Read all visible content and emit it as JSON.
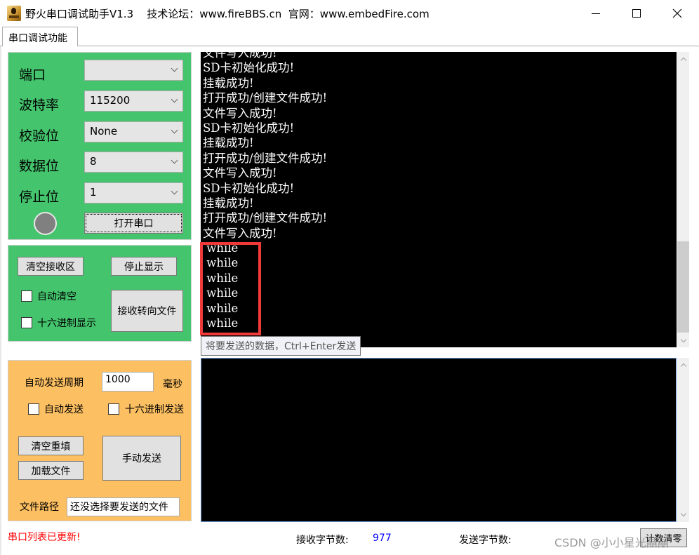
{
  "window": {
    "title": "野火串口调试助手V1.3    技术论坛：www.fireBBS.cn  官网：www.embedFire.com",
    "controls": [
      "minimize",
      "maximize",
      "close"
    ]
  },
  "tabs": [
    {
      "label": "串口调试功能",
      "active": true
    }
  ],
  "serial_settings": {
    "port": {
      "label": "端口",
      "value": ""
    },
    "baud": {
      "label": "波特率",
      "value": "115200"
    },
    "parity": {
      "label": "校验位",
      "value": "None"
    },
    "data_bits": {
      "label": "数据位",
      "value": "8"
    },
    "stop_bits": {
      "label": "停止位",
      "value": "1"
    },
    "open_button": "打开串口",
    "status_led_color": "#808080"
  },
  "receive_settings": {
    "clear_button": "清空接收区",
    "stop_display_button": "停止显示",
    "auto_clear": {
      "label": "自动清空",
      "checked": false
    },
    "hex_display": {
      "label": "十六进制显示",
      "checked": false
    },
    "redirect_button": "接收转向文件"
  },
  "send_settings": {
    "period_label": "自动发送周期",
    "period_value": "1000",
    "period_unit": "毫秒",
    "auto_send": {
      "label": "自动发送",
      "checked": false
    },
    "hex_send": {
      "label": "十六进制发送",
      "checked": false
    },
    "clear_refill_button": "清空重填",
    "load_file_button": "加载文件",
    "manual_send_button": "手动发送",
    "file_path_label": "文件路径",
    "file_path_value": "还没选择要发送的文件"
  },
  "receive_area": {
    "lines": [
      "文件写入成功!",
      "SD卡初始化成功!",
      "挂载成功!",
      "打开成功/创建文件成功!",
      "文件写入成功!",
      "SD卡初始化成功!",
      "挂载成功!",
      "打开成功/创建文件成功!",
      "文件写入成功!",
      "SD卡初始化成功!",
      "挂载成功!",
      "打开成功/创建文件成功!",
      "文件写入成功!",
      " while",
      " while",
      " while",
      " while",
      " while",
      " while"
    ]
  },
  "send_area": {
    "tooltip": "将要发送的数据，Ctrl+Enter发送",
    "value": ""
  },
  "status_bar": {
    "message": "串口列表已更新!",
    "rx_label": "接收字节数:",
    "rx_value": "977",
    "tx_label": "发送字节数:",
    "tx_value": "",
    "reset_button": "计数清零"
  },
  "watermark": "CSDN @小小星光晶晶",
  "colors": {
    "serial_panel": "#44c46d",
    "receive_panel": "#44c46d",
    "send_panel": "#fcbf61",
    "highlight": "#f03a3a",
    "status_message": "#ff0000",
    "rx_count": "#0000ff"
  }
}
